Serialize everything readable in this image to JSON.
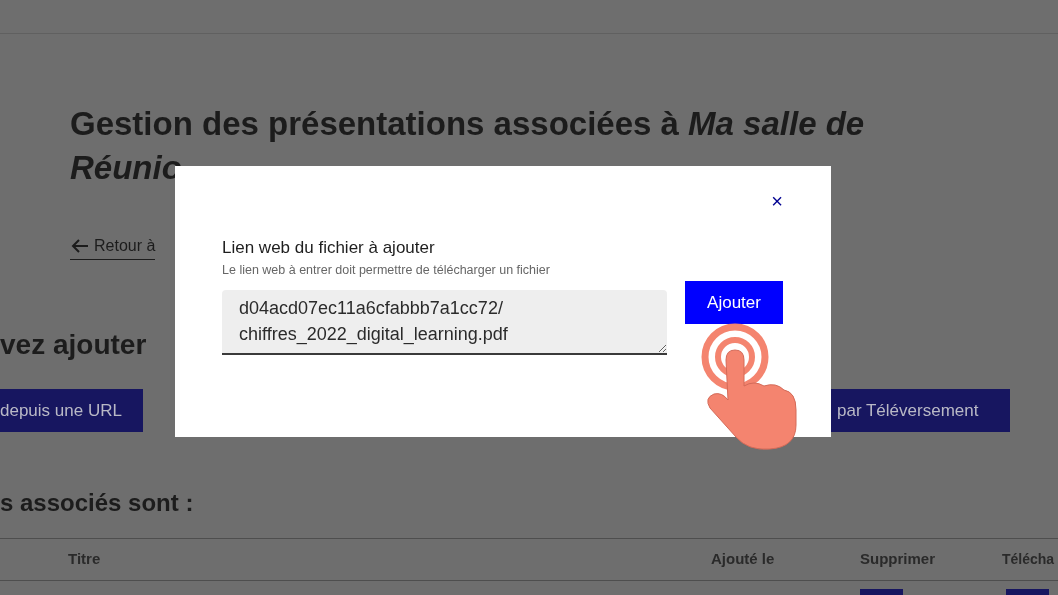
{
  "page": {
    "title": "Gestion des présentations associées à *Ma salle de Réunio*",
    "back_link": "Retour à",
    "section_heading": "vez ajouter",
    "buttons": [
      "depuis une URL",
      "par Téléversement"
    ],
    "list_heading": "s associés sont :",
    "table": {
      "columns": [
        "Titre",
        "Ajouté le",
        "Supprimer",
        "Télécha"
      ]
    }
  },
  "dialog": {
    "label": "Lien web du fichier à ajouter",
    "hint": "Le lien web à entrer doit permettre de télécharger un fichier",
    "value": "d04acd07ec11a6cfabbb7a1cc72/\nchiffres_2022_digital_learning.pdf",
    "submit": "Ajouter",
    "close": "×"
  }
}
